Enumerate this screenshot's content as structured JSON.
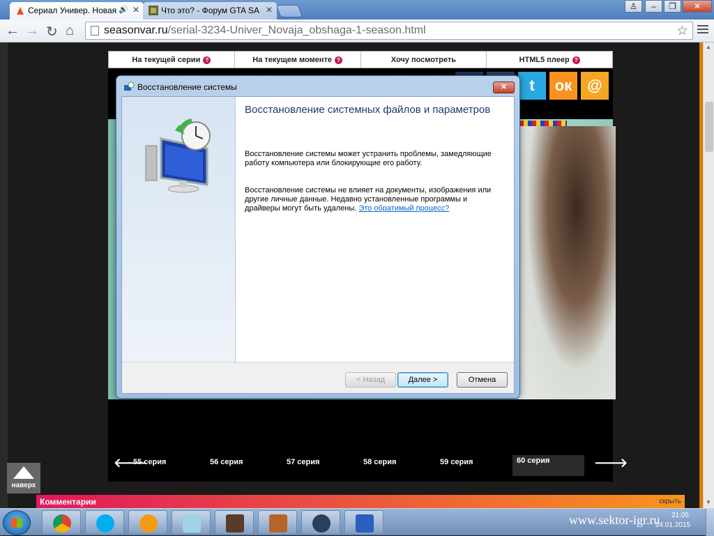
{
  "browser": {
    "tabs": [
      {
        "title": "Сериал Универ. Новая",
        "active": true
      },
      {
        "title": "Что это? - Форум GTA SA",
        "active": false
      }
    ],
    "url_host": "seasonvar.ru",
    "url_path": "/serial-3234-Univer_Novaja_obshaga-1-season.html",
    "window_controls": {
      "user": "♙",
      "minimize": "–",
      "restore": "❐",
      "close": "✕"
    }
  },
  "site": {
    "menu": [
      {
        "label": "На текущей серии",
        "help": true
      },
      {
        "label": "На текущем моменте",
        "help": true
      },
      {
        "label": "Хочу посмотреть",
        "help": false
      },
      {
        "label": "HTML5 плеер",
        "help": true
      }
    ],
    "social": [
      {
        "icon": "twitter-icon",
        "glyph": "t",
        "color": "#2aa9e0"
      },
      {
        "icon": "odnoklassniki-icon",
        "glyph": "ок",
        "color": "#f7931e"
      },
      {
        "icon": "mail-icon",
        "glyph": "@",
        "color": "#f5a623"
      }
    ],
    "episodes": [
      "55 серия",
      "56 серия",
      "57 серия",
      "58 серия",
      "59 серия",
      "60 серия"
    ],
    "current_episode": "60 серия",
    "to_top": "наверх",
    "comments_title": "Комментарии",
    "comments_hide": "скрыть"
  },
  "dialog": {
    "title": "Восстановление системы",
    "heading": "Восстановление системных файлов и параметров",
    "para1": "Восстановление системы может устранить проблемы, замедляющие работу компьютера или блокирующие его работу.",
    "para2": "Восстановление системы не влияет на документы, изображения или другие личные данные. Недавно установленные программы и драйверы могут быть удалены.",
    "link": "Это обратимый процесс?",
    "back_button": "< Назад",
    "next_button": "Далее >",
    "cancel_button": "Отмена"
  },
  "taskbar": {
    "apps": [
      "chrome-icon",
      "skype-icon",
      "aimp-icon",
      "notepad-icon",
      "gta-icon",
      "gta-sa-icon",
      "steam-icon",
      "system-restore-icon"
    ],
    "watermark": "www.sektor-igr.ru",
    "time": "21:05",
    "date": "24.01.2015"
  }
}
